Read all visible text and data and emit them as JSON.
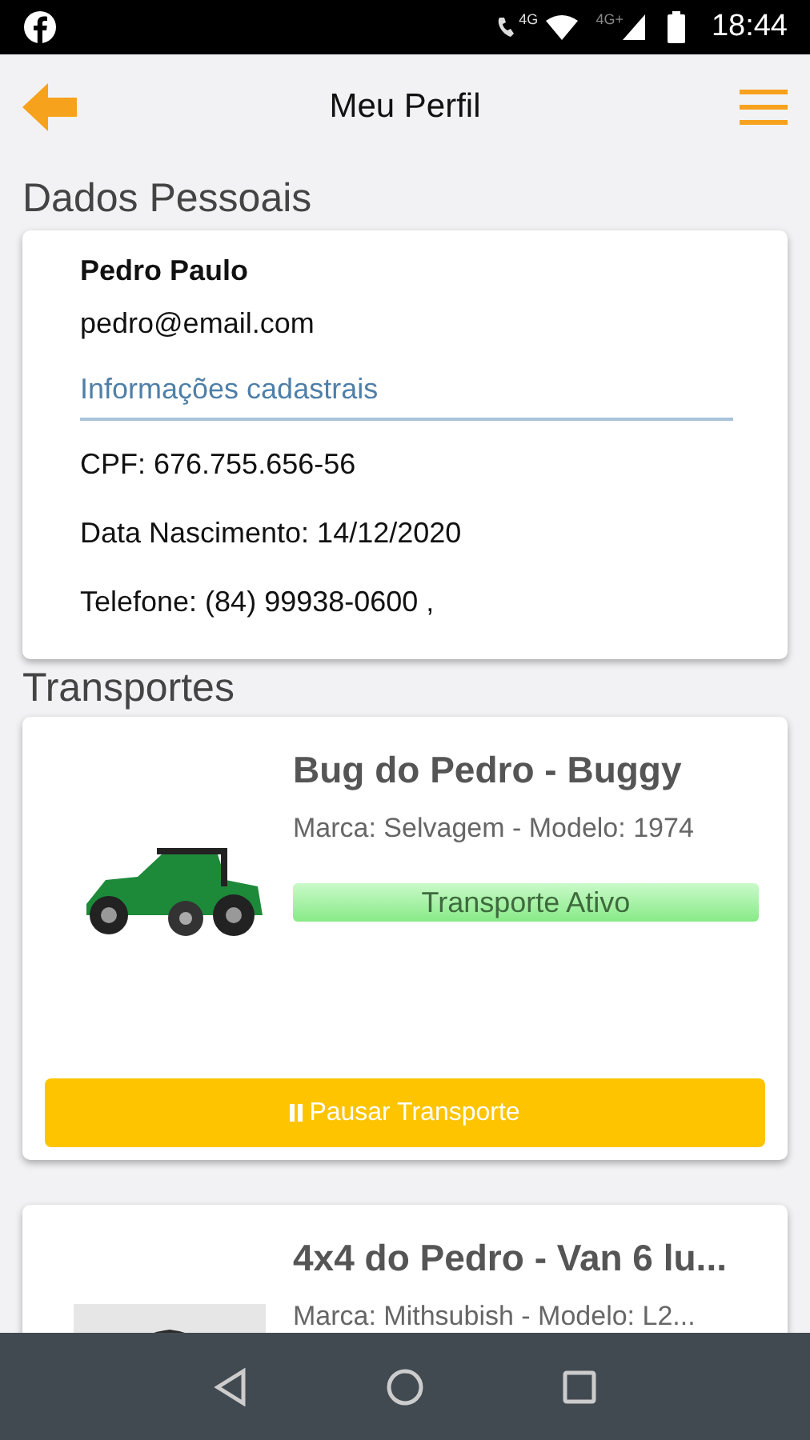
{
  "status_bar": {
    "time": "18:44",
    "network_label": "4G",
    "network_label_2": "4G+"
  },
  "header": {
    "title": "Meu Perfil"
  },
  "personal": {
    "heading": "Dados Pessoais",
    "name": "Pedro Paulo",
    "email": "pedro@email.com",
    "section_link": "Informações cadastrais",
    "fields": [
      "CPF: 676.755.656-56",
      "Data Nascimento: 14/12/2020",
      "Telefone: (84) 99938-0600 ,"
    ]
  },
  "transports_heading": "Transportes",
  "transports": [
    {
      "title": "Bug do Pedro - Buggy",
      "details": "Marca: Selvagem - Modelo: 1974",
      "status": "Transporte Ativo",
      "action": "Pausar Transporte"
    },
    {
      "title": "4x4 do Pedro - Van 6 lu...",
      "details": "Marca: Mithsubish - Modelo: L2..."
    }
  ]
}
